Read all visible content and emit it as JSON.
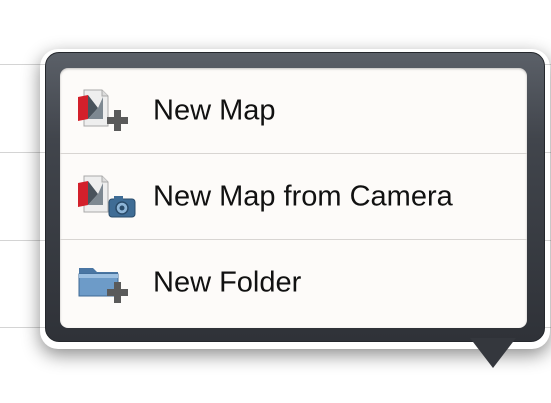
{
  "menu": {
    "items": [
      {
        "label": "New Map",
        "icon": "new-map-icon"
      },
      {
        "label": "New Map from Camera",
        "icon": "new-map-camera-icon"
      },
      {
        "label": "New Folder",
        "icon": "new-folder-icon"
      }
    ]
  },
  "colors": {
    "popover_frame": "#3b3f45",
    "menu_background": "#fdfbf9",
    "brand_red": "#d3202b",
    "folder_blue": "#5a86b4"
  }
}
